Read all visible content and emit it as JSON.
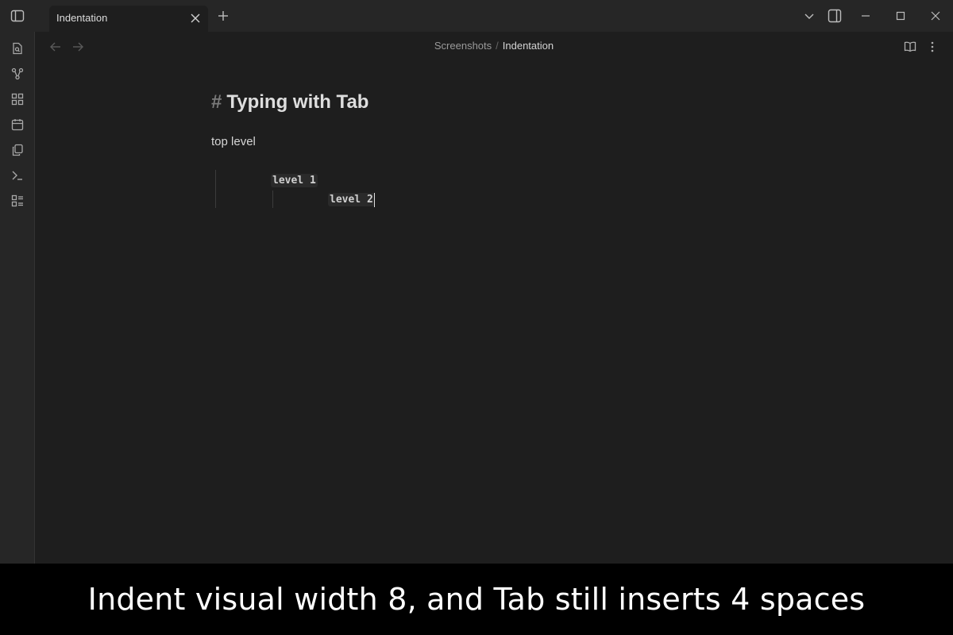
{
  "tab": {
    "title": "Indentation"
  },
  "breadcrumb": {
    "folder": "Screenshots",
    "separator": "/",
    "current": "Indentation"
  },
  "editor": {
    "heading_marker": "#",
    "heading": "Typing with Tab",
    "paragraph": "top level",
    "level1": "level 1",
    "level2": "level 2"
  },
  "caption": "Indent visual width 8, and Tab still inserts 4 spaces",
  "icons": {
    "titlebar": [
      "sidebar-toggle-icon",
      "close-icon",
      "plus-icon",
      "chevron-down-icon",
      "right-sidebar-icon",
      "minimize-icon",
      "maximize-icon",
      "close-window-icon"
    ],
    "ribbon": [
      "open-quick-switcher-icon",
      "graph-view-icon",
      "canvas-icon",
      "calendar-icon",
      "templates-icon",
      "command-palette-icon",
      "bases-icon"
    ],
    "header": [
      "back-arrow-icon",
      "forward-arrow-icon",
      "reading-view-icon",
      "more-options-icon"
    ]
  },
  "colors": {
    "background": "#1e1e1e",
    "sidebar": "#262626",
    "caption_bg": "#000000"
  }
}
